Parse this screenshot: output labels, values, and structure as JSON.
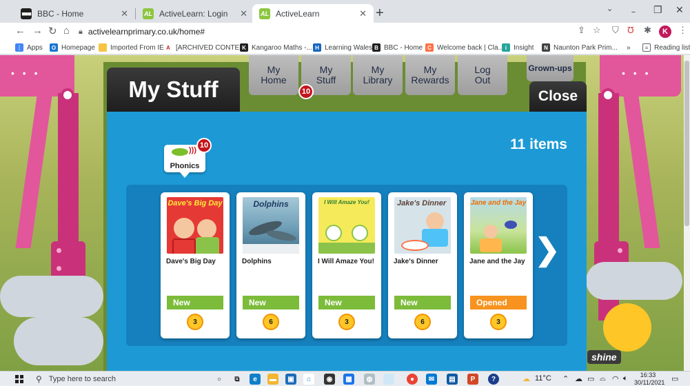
{
  "browser": {
    "tabs": [
      {
        "title": "BBC - Home",
        "favicon": "bbc-icon",
        "active": false
      },
      {
        "title": "ActiveLearn: Login",
        "favicon": "activelearn-icon",
        "active": false
      },
      {
        "title": "ActiveLearn",
        "favicon": "activelearn-icon",
        "active": true
      }
    ],
    "new_tab": "+",
    "window": {
      "minimize": "﹣",
      "restore": "❐",
      "close": "✕"
    },
    "address": "activelearnprimary.co.uk/home#",
    "profile_initial": "K",
    "bookmarks": [
      {
        "label": "Apps"
      },
      {
        "label": "Homepage"
      },
      {
        "label": "Imported From IE"
      },
      {
        "label": "[ARCHIVED CONTE..."
      },
      {
        "label": "Kangaroo Maths -..."
      },
      {
        "label": "Learning Wales"
      },
      {
        "label": "BBC - Home"
      },
      {
        "label": "Welcome back | Cla..."
      },
      {
        "label": "Insight"
      },
      {
        "label": "Naunton Park Prim..."
      }
    ],
    "bookmarks_more": "»",
    "reading_list": "Reading list"
  },
  "app": {
    "title": "My Stuff",
    "nav": [
      {
        "label_line1": "My",
        "label_line2": "Home"
      },
      {
        "label_line1": "My",
        "label_line2": "Stuff"
      },
      {
        "label_line1": "My",
        "label_line2": "Library"
      },
      {
        "label_line1": "My",
        "label_line2": "Rewards"
      },
      {
        "label_line1": "Log",
        "label_line2": "Out"
      }
    ],
    "nav_badge": "10",
    "grownups": "Grown-ups",
    "close": "Close",
    "items_count": "11 items",
    "category": {
      "label": "Phonics",
      "badge": "10"
    },
    "next_arrow": "❯",
    "books": [
      {
        "cover_title": "Dave's Big Day",
        "title": "Dave's Big Day",
        "status": "New",
        "points": "3",
        "status_type": "new"
      },
      {
        "cover_title": "Dolphins",
        "title": "Dolphins",
        "status": "New",
        "points": "6",
        "status_type": "new"
      },
      {
        "cover_title": "I Will Amaze You!",
        "title": "I Will Amaze You!",
        "status": "New",
        "points": "3",
        "status_type": "new"
      },
      {
        "cover_title": "Jake's Dinner",
        "title": "Jake's Dinner",
        "status": "New",
        "points": "6",
        "status_type": "new"
      },
      {
        "cover_title": "Jane and the Jay",
        "title": "Jane and the Jay",
        "status": "Opened",
        "points": "3",
        "status_type": "opened"
      }
    ],
    "shine_logo": "shine"
  },
  "taskbar": {
    "search_placeholder": "Type here to search",
    "weather": "11°C",
    "time": "16:33",
    "date": "30/11/2021"
  },
  "colors": {
    "panel_blue": "#1d9ad6",
    "new_green": "#7cbc3a",
    "opened_orange": "#f7931e",
    "badge_red": "#c4151c",
    "coin_yellow": "#ffc627"
  }
}
